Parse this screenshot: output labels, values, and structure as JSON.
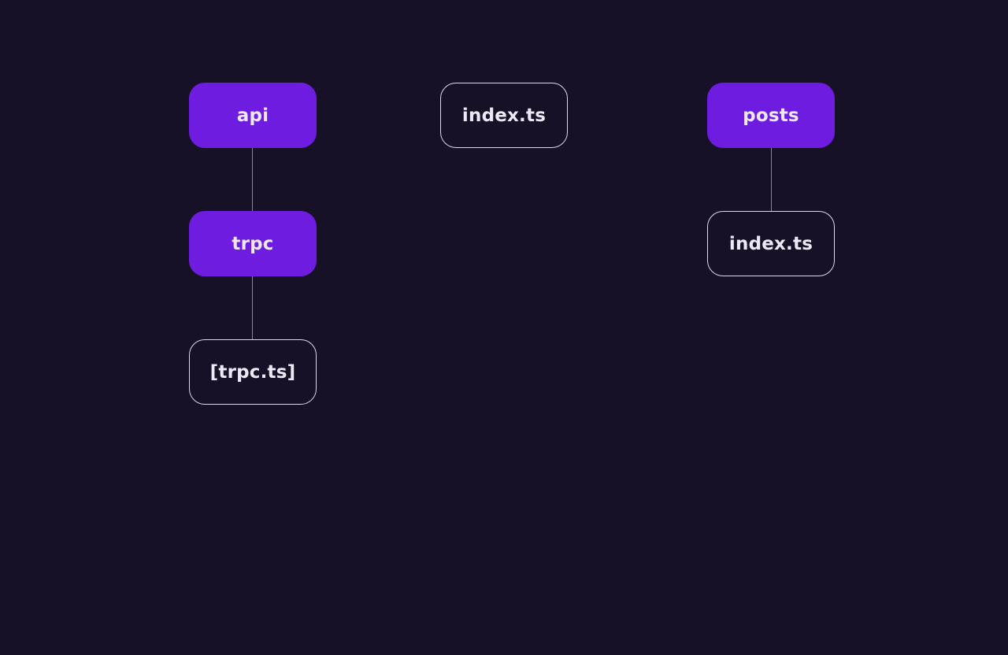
{
  "colors": {
    "background": "#161126",
    "folder_fill": "#6d1ce0",
    "file_border": "#ded9e8",
    "text": "#ede8f5",
    "connector": "#8a8594"
  },
  "nodes": {
    "api": {
      "label": "api",
      "kind": "folder"
    },
    "trpc": {
      "label": "trpc",
      "kind": "folder"
    },
    "trpc_ts": {
      "label": "[trpc.ts]",
      "kind": "file"
    },
    "index_root": {
      "label": "index.ts",
      "kind": "file"
    },
    "posts": {
      "label": "posts",
      "kind": "folder"
    },
    "posts_index": {
      "label": "index.ts",
      "kind": "file"
    }
  },
  "edges": [
    {
      "from": "api",
      "to": "trpc"
    },
    {
      "from": "trpc",
      "to": "trpc_ts"
    },
    {
      "from": "posts",
      "to": "posts_index"
    }
  ]
}
